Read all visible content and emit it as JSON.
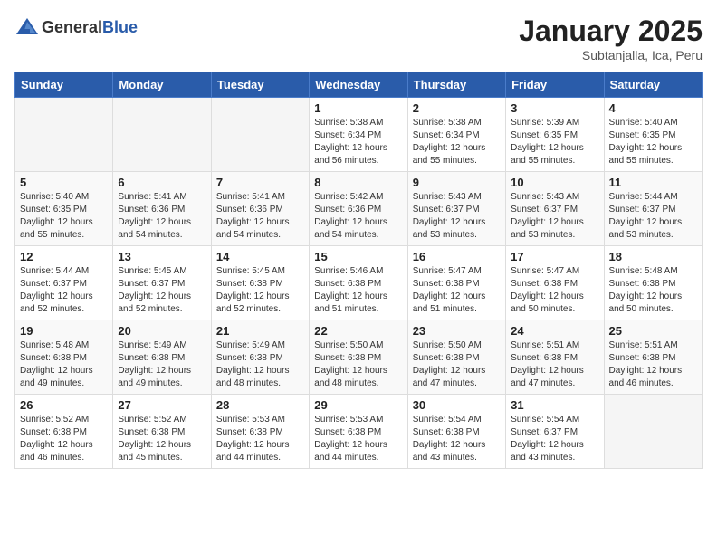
{
  "header": {
    "logo_general": "General",
    "logo_blue": "Blue",
    "month_title": "January 2025",
    "subtitle": "Subtanjalla, Ica, Peru"
  },
  "weekdays": [
    "Sunday",
    "Monday",
    "Tuesday",
    "Wednesday",
    "Thursday",
    "Friday",
    "Saturday"
  ],
  "weeks": [
    [
      {
        "day": "",
        "info": ""
      },
      {
        "day": "",
        "info": ""
      },
      {
        "day": "",
        "info": ""
      },
      {
        "day": "1",
        "info": "Sunrise: 5:38 AM\nSunset: 6:34 PM\nDaylight: 12 hours\nand 56 minutes."
      },
      {
        "day": "2",
        "info": "Sunrise: 5:38 AM\nSunset: 6:34 PM\nDaylight: 12 hours\nand 55 minutes."
      },
      {
        "day": "3",
        "info": "Sunrise: 5:39 AM\nSunset: 6:35 PM\nDaylight: 12 hours\nand 55 minutes."
      },
      {
        "day": "4",
        "info": "Sunrise: 5:40 AM\nSunset: 6:35 PM\nDaylight: 12 hours\nand 55 minutes."
      }
    ],
    [
      {
        "day": "5",
        "info": "Sunrise: 5:40 AM\nSunset: 6:35 PM\nDaylight: 12 hours\nand 55 minutes."
      },
      {
        "day": "6",
        "info": "Sunrise: 5:41 AM\nSunset: 6:36 PM\nDaylight: 12 hours\nand 54 minutes."
      },
      {
        "day": "7",
        "info": "Sunrise: 5:41 AM\nSunset: 6:36 PM\nDaylight: 12 hours\nand 54 minutes."
      },
      {
        "day": "8",
        "info": "Sunrise: 5:42 AM\nSunset: 6:36 PM\nDaylight: 12 hours\nand 54 minutes."
      },
      {
        "day": "9",
        "info": "Sunrise: 5:43 AM\nSunset: 6:37 PM\nDaylight: 12 hours\nand 53 minutes."
      },
      {
        "day": "10",
        "info": "Sunrise: 5:43 AM\nSunset: 6:37 PM\nDaylight: 12 hours\nand 53 minutes."
      },
      {
        "day": "11",
        "info": "Sunrise: 5:44 AM\nSunset: 6:37 PM\nDaylight: 12 hours\nand 53 minutes."
      }
    ],
    [
      {
        "day": "12",
        "info": "Sunrise: 5:44 AM\nSunset: 6:37 PM\nDaylight: 12 hours\nand 52 minutes."
      },
      {
        "day": "13",
        "info": "Sunrise: 5:45 AM\nSunset: 6:37 PM\nDaylight: 12 hours\nand 52 minutes."
      },
      {
        "day": "14",
        "info": "Sunrise: 5:45 AM\nSunset: 6:38 PM\nDaylight: 12 hours\nand 52 minutes."
      },
      {
        "day": "15",
        "info": "Sunrise: 5:46 AM\nSunset: 6:38 PM\nDaylight: 12 hours\nand 51 minutes."
      },
      {
        "day": "16",
        "info": "Sunrise: 5:47 AM\nSunset: 6:38 PM\nDaylight: 12 hours\nand 51 minutes."
      },
      {
        "day": "17",
        "info": "Sunrise: 5:47 AM\nSunset: 6:38 PM\nDaylight: 12 hours\nand 50 minutes."
      },
      {
        "day": "18",
        "info": "Sunrise: 5:48 AM\nSunset: 6:38 PM\nDaylight: 12 hours\nand 50 minutes."
      }
    ],
    [
      {
        "day": "19",
        "info": "Sunrise: 5:48 AM\nSunset: 6:38 PM\nDaylight: 12 hours\nand 49 minutes."
      },
      {
        "day": "20",
        "info": "Sunrise: 5:49 AM\nSunset: 6:38 PM\nDaylight: 12 hours\nand 49 minutes."
      },
      {
        "day": "21",
        "info": "Sunrise: 5:49 AM\nSunset: 6:38 PM\nDaylight: 12 hours\nand 48 minutes."
      },
      {
        "day": "22",
        "info": "Sunrise: 5:50 AM\nSunset: 6:38 PM\nDaylight: 12 hours\nand 48 minutes."
      },
      {
        "day": "23",
        "info": "Sunrise: 5:50 AM\nSunset: 6:38 PM\nDaylight: 12 hours\nand 47 minutes."
      },
      {
        "day": "24",
        "info": "Sunrise: 5:51 AM\nSunset: 6:38 PM\nDaylight: 12 hours\nand 47 minutes."
      },
      {
        "day": "25",
        "info": "Sunrise: 5:51 AM\nSunset: 6:38 PM\nDaylight: 12 hours\nand 46 minutes."
      }
    ],
    [
      {
        "day": "26",
        "info": "Sunrise: 5:52 AM\nSunset: 6:38 PM\nDaylight: 12 hours\nand 46 minutes."
      },
      {
        "day": "27",
        "info": "Sunrise: 5:52 AM\nSunset: 6:38 PM\nDaylight: 12 hours\nand 45 minutes."
      },
      {
        "day": "28",
        "info": "Sunrise: 5:53 AM\nSunset: 6:38 PM\nDaylight: 12 hours\nand 44 minutes."
      },
      {
        "day": "29",
        "info": "Sunrise: 5:53 AM\nSunset: 6:38 PM\nDaylight: 12 hours\nand 44 minutes."
      },
      {
        "day": "30",
        "info": "Sunrise: 5:54 AM\nSunset: 6:38 PM\nDaylight: 12 hours\nand 43 minutes."
      },
      {
        "day": "31",
        "info": "Sunrise: 5:54 AM\nSunset: 6:37 PM\nDaylight: 12 hours\nand 43 minutes."
      },
      {
        "day": "",
        "info": ""
      }
    ]
  ]
}
